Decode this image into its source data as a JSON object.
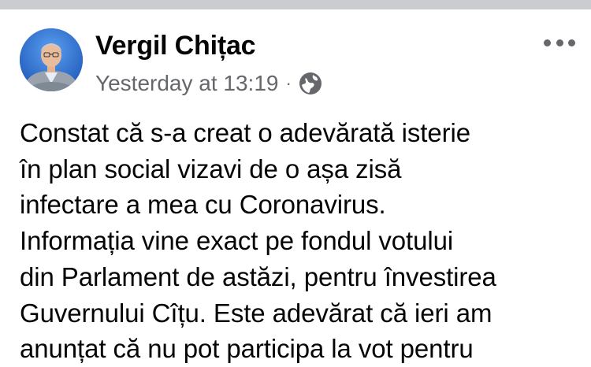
{
  "post": {
    "author_name": "Vergil Chițac",
    "timestamp": "Yesterday at 13:19",
    "separator": "·",
    "audience_icon": "globe-icon",
    "more_icon": "more-options-icon",
    "avatar_icon": "profile-photo",
    "text_lines": [
      "Constat că s-a creat o adevărată isterie",
      "în plan social vizavi de o așa zisă",
      "infectare a mea cu Coronavirus.",
      "Informația vine exact pe fondul votului",
      "din Parlament de astăzi, pentru învestirea",
      "Guvernului Cîțu. Este adevărat că ieri am",
      "anunțat că nu pot participa la vot pentru"
    ]
  },
  "colors": {
    "text_primary": "#050505",
    "text_secondary": "#65676b",
    "background": "#ffffff",
    "separator_bar": "#cbccd0"
  }
}
